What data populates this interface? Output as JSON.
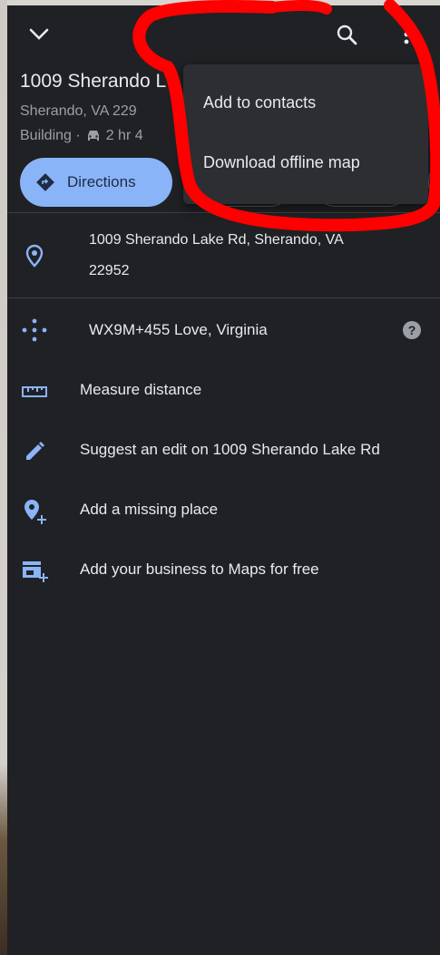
{
  "header": {
    "collapse_icon": "chevron-down-icon",
    "search_icon": "search-icon",
    "more_icon": "more-vert-icon"
  },
  "place": {
    "title": "1009 Sherando L",
    "address_short": "Sherando, VA 229",
    "type": "Building ·",
    "drive_time": "2 hr 4"
  },
  "actions": {
    "directions_label": "Directions"
  },
  "details": {
    "full_address_line1": "1009 Sherando Lake Rd, Sherando, VA",
    "full_address_line2": "22952",
    "plus_code": "WX9M+455 Love, Virginia",
    "measure_distance": "Measure distance",
    "suggest_edit": "Suggest an edit on 1009 Sherando Lake Rd",
    "add_missing_place": "Add a missing place",
    "add_business": "Add your business to Maps for free"
  },
  "menu": {
    "items": [
      {
        "label": "Add to contacts"
      },
      {
        "label": "Download offline map"
      }
    ]
  },
  "colors": {
    "panel_bg": "#202124",
    "accent_blue": "#8ab4f8",
    "menu_bg": "#2d2e31",
    "annotation_red": "#ff0000"
  }
}
